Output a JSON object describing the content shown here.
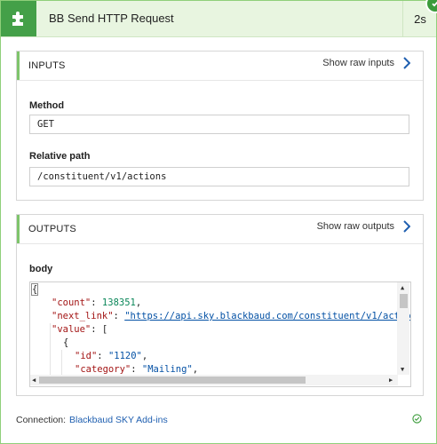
{
  "header": {
    "title": "BB Send HTTP Request",
    "duration": "2s",
    "icon": "puzzle-piece-icon",
    "status_icon": "success-check-icon",
    "accent": "#44a048"
  },
  "inputs": {
    "section_title": "INPUTS",
    "raw_link": "Show raw inputs",
    "method_label": "Method",
    "method_value": "GET",
    "path_label": "Relative path",
    "path_value": "/constituent/v1/actions"
  },
  "outputs": {
    "section_title": "OUTPUTS",
    "raw_link": "Show raw outputs",
    "body_label": "body",
    "code": {
      "l1": "{",
      "count_key": "\"count\"",
      "count_value": "138351",
      "next_link_key": "\"next_link\"",
      "next_link_value": "\"https://api.sky.blackbaud.com/constituent/v1/action",
      "value_key": "\"value\"",
      "value_open": "[",
      "obj_open": "{",
      "id_key": "\"id\"",
      "id_value": "\"1120\"",
      "category_key": "\"category\"",
      "category_value": "\"Mailing\""
    }
  },
  "footer": {
    "connection_label": "Connection:",
    "connection_name": "Blackbaud SKY Add-ins"
  }
}
